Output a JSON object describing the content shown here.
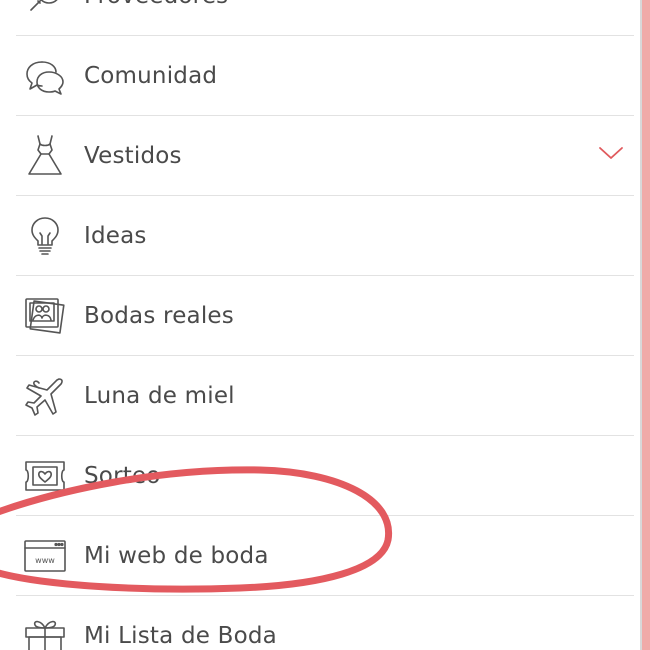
{
  "theme": {
    "accent": "#e0595c",
    "annotation": "#e35a5f",
    "text": "#4a4a4a",
    "icon_stroke": "#555555",
    "strip": "#f0aaa8"
  },
  "menu": {
    "items": [
      {
        "label": "Proveedores",
        "icon": "magnifier-icon"
      },
      {
        "label": "Comunidad",
        "icon": "chat-bubbles-icon"
      },
      {
        "label": "Vestidos",
        "icon": "dress-icon",
        "expandable": true
      },
      {
        "label": "Ideas",
        "icon": "lightbulb-icon"
      },
      {
        "label": "Bodas reales",
        "icon": "photos-icon"
      },
      {
        "label": "Luna de miel",
        "icon": "airplane-icon"
      },
      {
        "label": "Sorteo",
        "icon": "ticket-heart-icon"
      },
      {
        "label": "Mi web de boda",
        "icon": "web-browser-icon"
      },
      {
        "label": "Mi Lista de Boda",
        "icon": "gift-icon"
      }
    ]
  }
}
